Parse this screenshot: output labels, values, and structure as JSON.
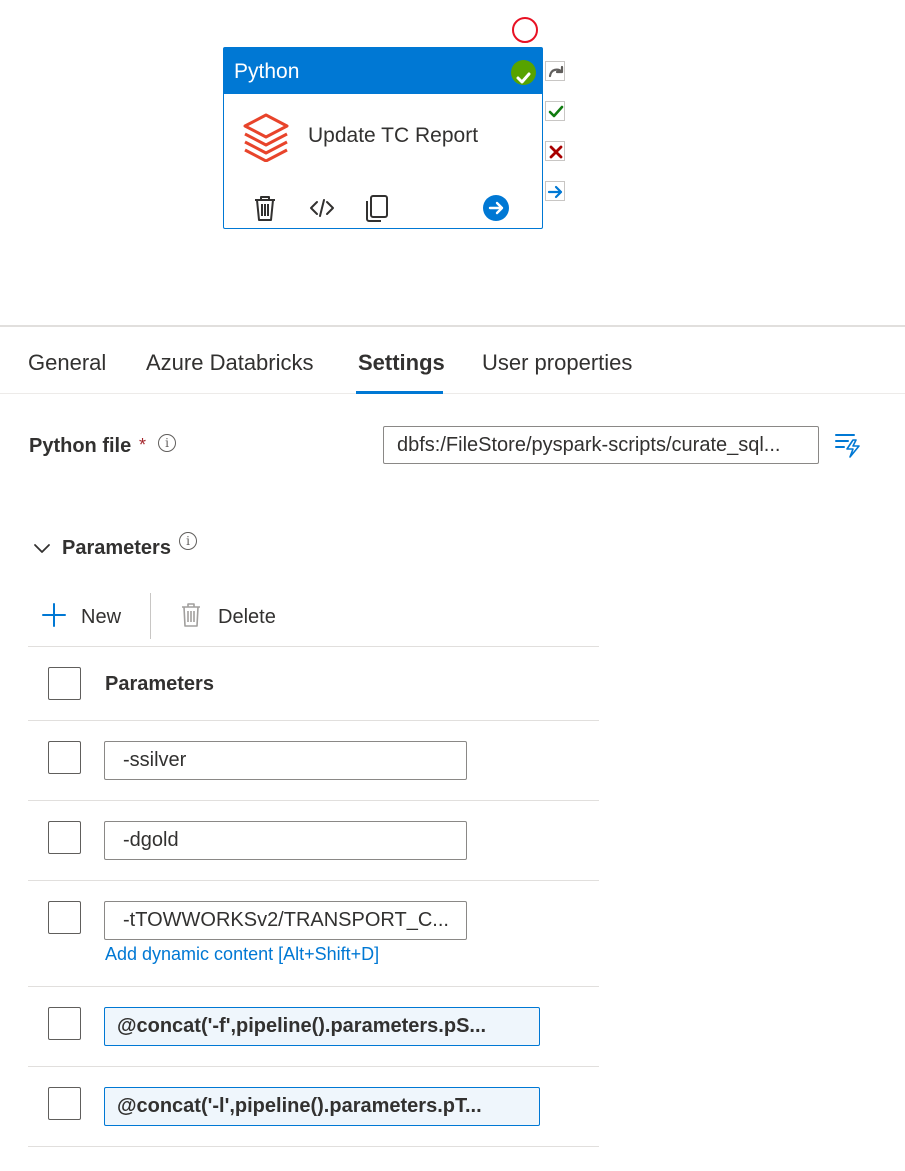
{
  "activity": {
    "type_label": "Python",
    "name": "Update TC Report"
  },
  "tabs": [
    {
      "label": "General"
    },
    {
      "label": "Azure Databricks"
    },
    {
      "label": "Settings"
    },
    {
      "label": "User properties"
    }
  ],
  "active_tab": "Settings",
  "python_file": {
    "label": "Python file",
    "required_mark": "*",
    "info_glyph": "i",
    "value": "dbfs:/FileStore/pyspark-scripts/curate_sql..."
  },
  "parameters_section": {
    "title": "Parameters",
    "info_glyph": "i",
    "new_label": "New",
    "delete_label": "Delete",
    "column_header": "Parameters",
    "rows": [
      {
        "value": "-ssilver"
      },
      {
        "value": "-dgold"
      },
      {
        "value": "-tTOWWORKSv2/TRANSPORT_C..."
      },
      {
        "value": "@concat('-f',pipeline().parameters.pS..."
      },
      {
        "value": "@concat('-l',pipeline().parameters.pT..."
      }
    ],
    "dynamic_content_link": "Add dynamic content [Alt+Shift+D]"
  },
  "colors": {
    "accent": "#0078d4",
    "success": "#57a300",
    "error": "#a80000",
    "databricks": "#e8442b"
  }
}
